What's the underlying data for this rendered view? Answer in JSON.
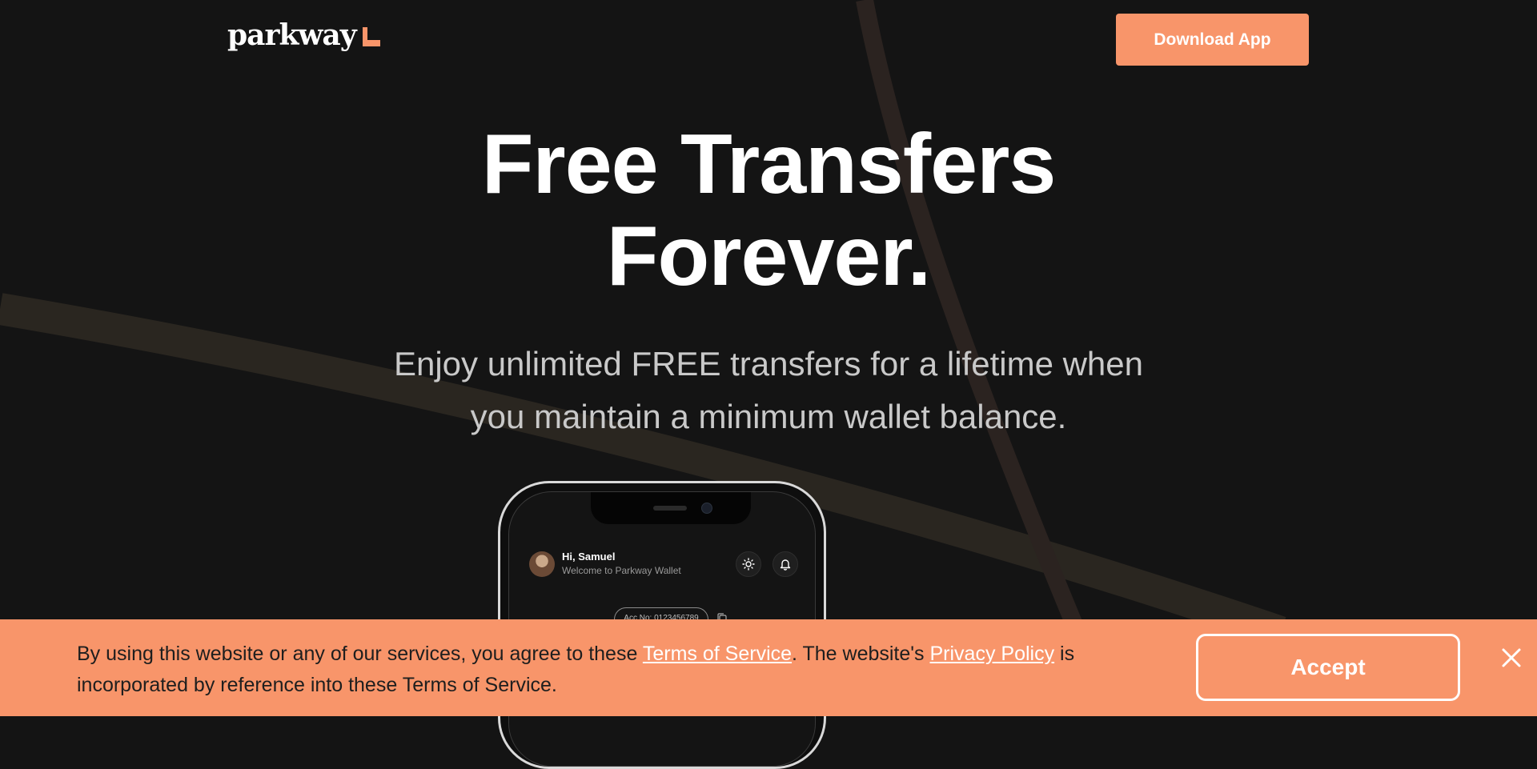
{
  "header": {
    "logo_text": "parkway",
    "download_label": "Download App"
  },
  "hero": {
    "title_line1": "Free Transfers",
    "title_line2": "Forever.",
    "subtitle_line1": "Enjoy unlimited FREE transfers for a lifetime when",
    "subtitle_line2": "you maintain a minimum wallet balance."
  },
  "phone": {
    "greeting": "Hi, Samuel",
    "welcome": "Welcome to Parkway Wallet",
    "account_label": "Acc No: 0123456789"
  },
  "cookie": {
    "text_before": "By using this website or any of our services, you agree to these ",
    "terms_link": "Terms of Service",
    "text_middle": ". The website's ",
    "privacy_link": "Privacy Policy",
    "text_after": " is incorporated by reference into these Terms of Service.",
    "accept_label": "Accept"
  },
  "colors": {
    "accent": "#f8956a",
    "background": "#141414"
  }
}
